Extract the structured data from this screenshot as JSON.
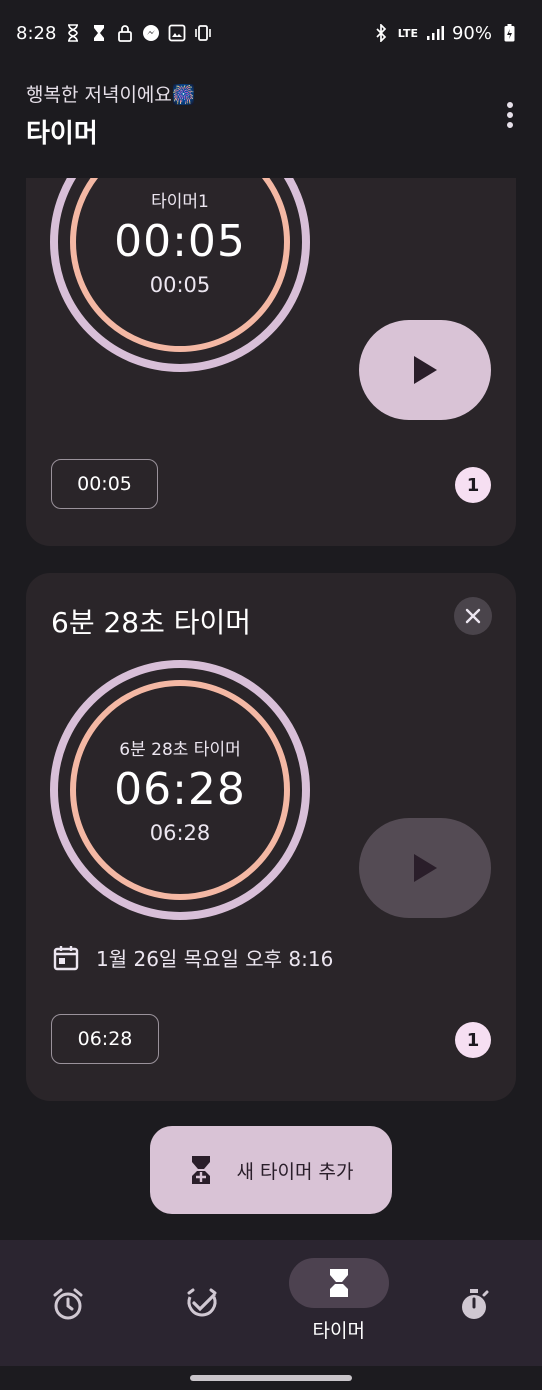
{
  "status": {
    "time": "8:28",
    "network": "LTE",
    "battery": "90%"
  },
  "header": {
    "greeting": "행복한 저녁이에요🎆",
    "title": "타이머"
  },
  "timers": [
    {
      "label": "타이머1",
      "remaining": "00:05",
      "total": "00:05",
      "chip": "00:05",
      "count": "1"
    },
    {
      "title": "6분 28초 타이머",
      "label": "6분 28초 타이머",
      "remaining": "06:28",
      "total": "06:28",
      "end_time": "1월 26일 목요일 오후 8:16",
      "chip": "06:28",
      "count": "1"
    }
  ],
  "fab": {
    "label": "새 타이머 추가"
  },
  "nav": {
    "items": [
      {
        "icon": "alarm-icon"
      },
      {
        "icon": "clock-check-icon"
      },
      {
        "icon": "hourglass-icon",
        "label": "타이머"
      },
      {
        "icon": "stopwatch-icon"
      }
    ]
  },
  "colors": {
    "background": "#1c1b1f",
    "card": "#2a2529",
    "ring_outer": "#d8bfd8",
    "ring_inner": "#f4b8a4",
    "accent": "#d9c3d6"
  }
}
